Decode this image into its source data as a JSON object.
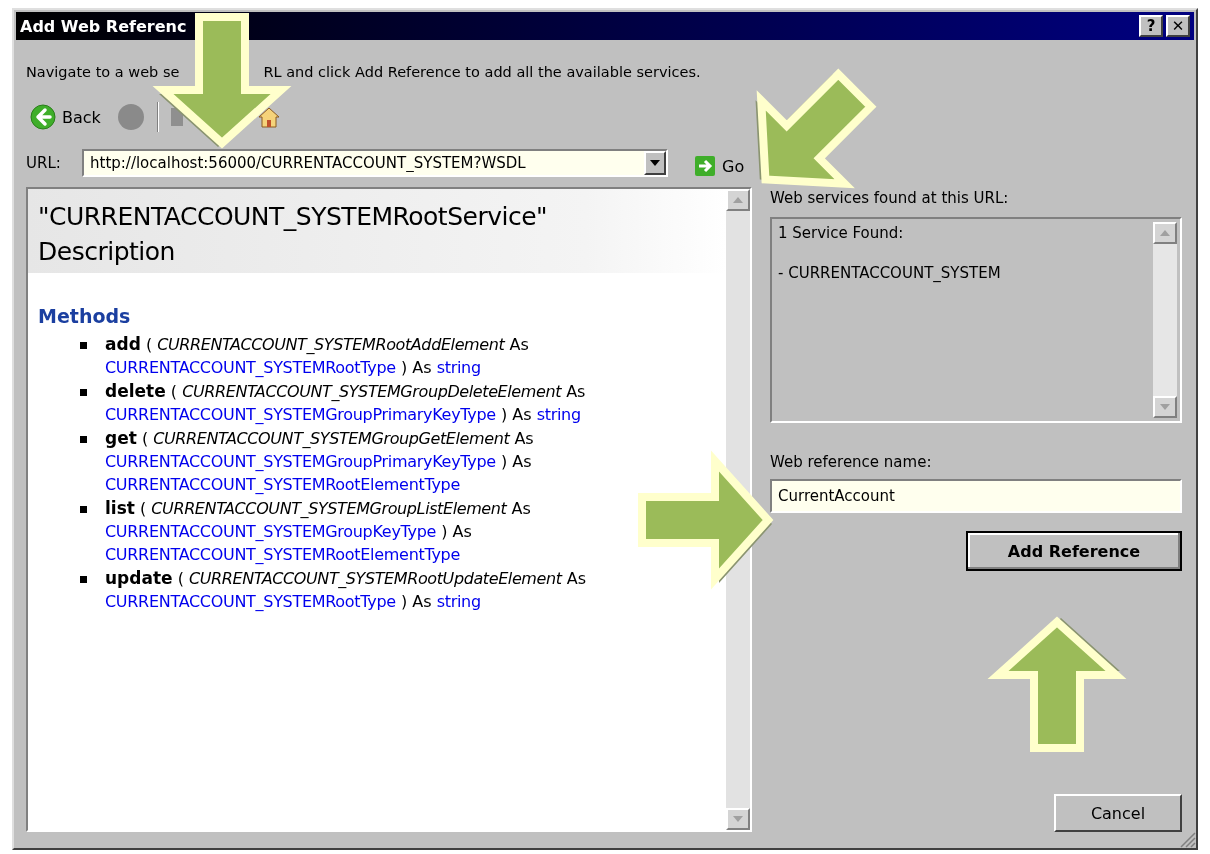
{
  "window": {
    "title": "Add Web Referenc",
    "buttons": [
      "?",
      "✕"
    ]
  },
  "instructions": [
    "Navigate to a web se",
    "RL and click Add Reference to add all the available services."
  ],
  "toolbar": [
    {
      "kind": "back",
      "label": "Back"
    },
    {
      "kind": "stop"
    },
    {
      "kind": "refresh"
    },
    {
      "kind": "home"
    }
  ],
  "url": {
    "label": "URL:",
    "value": "http://localhost:56000/CURRENTACCOUNT_SYSTEM?WSDL",
    "go": "Go"
  },
  "description": {
    "title": "\"CURRENTACCOUNT_SYSTEMRootService\" Description",
    "methods_heading": "Methods",
    "methods": [
      {
        "parts": [
          {
            "kind": "name",
            "text": "add"
          },
          {
            "kind": "plain",
            "text": "("
          },
          {
            "kind": "param",
            "text": "CURRENTACCOUNT_SYSTEMRootAddElement"
          },
          {
            "kind": "plain",
            "text": "As"
          },
          {
            "kind": "link",
            "text": "CURRENTACCOUNT_SYSTEMRootType"
          },
          {
            "kind": "plain",
            "text": ") As"
          },
          {
            "kind": "link",
            "text": "string"
          }
        ]
      },
      {
        "parts": [
          {
            "kind": "name",
            "text": "delete"
          },
          {
            "kind": "plain",
            "text": "("
          },
          {
            "kind": "param",
            "text": "CURRENTACCOUNT_SYSTEMGroupDeleteElement"
          },
          {
            "kind": "plain",
            "text": "As"
          },
          {
            "kind": "link",
            "text": "CURRENTACCOUNT_SYSTEMGroupPrimaryKeyType"
          },
          {
            "kind": "plain",
            "text": ") As"
          },
          {
            "kind": "link",
            "text": "string"
          }
        ]
      },
      {
        "parts": [
          {
            "kind": "name",
            "text": "get"
          },
          {
            "kind": "plain",
            "text": "("
          },
          {
            "kind": "param",
            "text": "CURRENTACCOUNT_SYSTEMGroupGetElement"
          },
          {
            "kind": "plain",
            "text": "As"
          },
          {
            "kind": "link",
            "text": "CURRENTACCOUNT_SYSTEMGroupPrimaryKeyType"
          },
          {
            "kind": "plain",
            "text": ") As"
          },
          {
            "kind": "link",
            "text": "CURRENTACCOUNT_SYSTEMRootElementType"
          }
        ]
      },
      {
        "parts": [
          {
            "kind": "name",
            "text": "list"
          },
          {
            "kind": "plain",
            "text": "("
          },
          {
            "kind": "param",
            "text": "CURRENTACCOUNT_SYSTEMGroupListElement"
          },
          {
            "kind": "plain",
            "text": "As"
          },
          {
            "kind": "link",
            "text": "CURRENTACCOUNT_SYSTEMGroupKeyType"
          },
          {
            "kind": "plain",
            "text": ") As"
          },
          {
            "kind": "link",
            "text": "CURRENTACCOUNT_SYSTEMRootElementType"
          }
        ]
      },
      {
        "parts": [
          {
            "kind": "name",
            "text": "update"
          },
          {
            "kind": "plain",
            "text": "("
          },
          {
            "kind": "param",
            "text": "CURRENTACCOUNT_SYSTEMRootUpdateElement"
          },
          {
            "kind": "plain",
            "text": "As"
          },
          {
            "kind": "link",
            "text": "CURRENTACCOUNT_SYSTEMRootType"
          },
          {
            "kind": "plain",
            "text": ") As"
          },
          {
            "kind": "link",
            "text": "string"
          }
        ]
      }
    ]
  },
  "services": {
    "label": "Web services found at this URL:",
    "lines": [
      "1 Service Found:",
      "- CURRENTACCOUNT_SYSTEM"
    ]
  },
  "reference_name": {
    "label": "Web reference name:",
    "value": "CurrentAccount"
  },
  "buttons": [
    {
      "kind": "add",
      "label": "Add Reference"
    },
    {
      "kind": "cancel",
      "label": "Cancel"
    }
  ]
}
